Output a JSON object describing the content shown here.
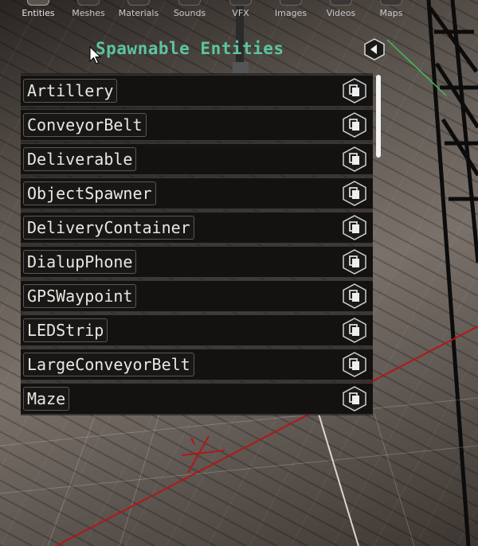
{
  "tabs": [
    {
      "label": "Entities",
      "active": true
    },
    {
      "label": "Meshes",
      "active": false
    },
    {
      "label": "Materials",
      "active": false
    },
    {
      "label": "Sounds",
      "active": false
    },
    {
      "label": "VFX",
      "active": false
    },
    {
      "label": "Images",
      "active": false
    },
    {
      "label": "Videos",
      "active": false
    },
    {
      "label": "Maps",
      "active": false
    }
  ],
  "panel": {
    "title": "Spawnable Entities",
    "back_icon": "chevron-left-icon",
    "item_action_icon": "copy-icon",
    "items": [
      {
        "label": "Artillery"
      },
      {
        "label": "ConveyorBelt"
      },
      {
        "label": "Deliverable"
      },
      {
        "label": "ObjectSpawner"
      },
      {
        "label": "DeliveryContainer"
      },
      {
        "label": "DialupPhone"
      },
      {
        "label": "GPSWaypoint"
      },
      {
        "label": "LEDStrip"
      },
      {
        "label": "LargeConveyorBelt"
      },
      {
        "label": "Maze"
      }
    ]
  },
  "colors": {
    "title": "#5cc4a0",
    "row_bg": "#141211",
    "text": "#e8e8e0"
  }
}
